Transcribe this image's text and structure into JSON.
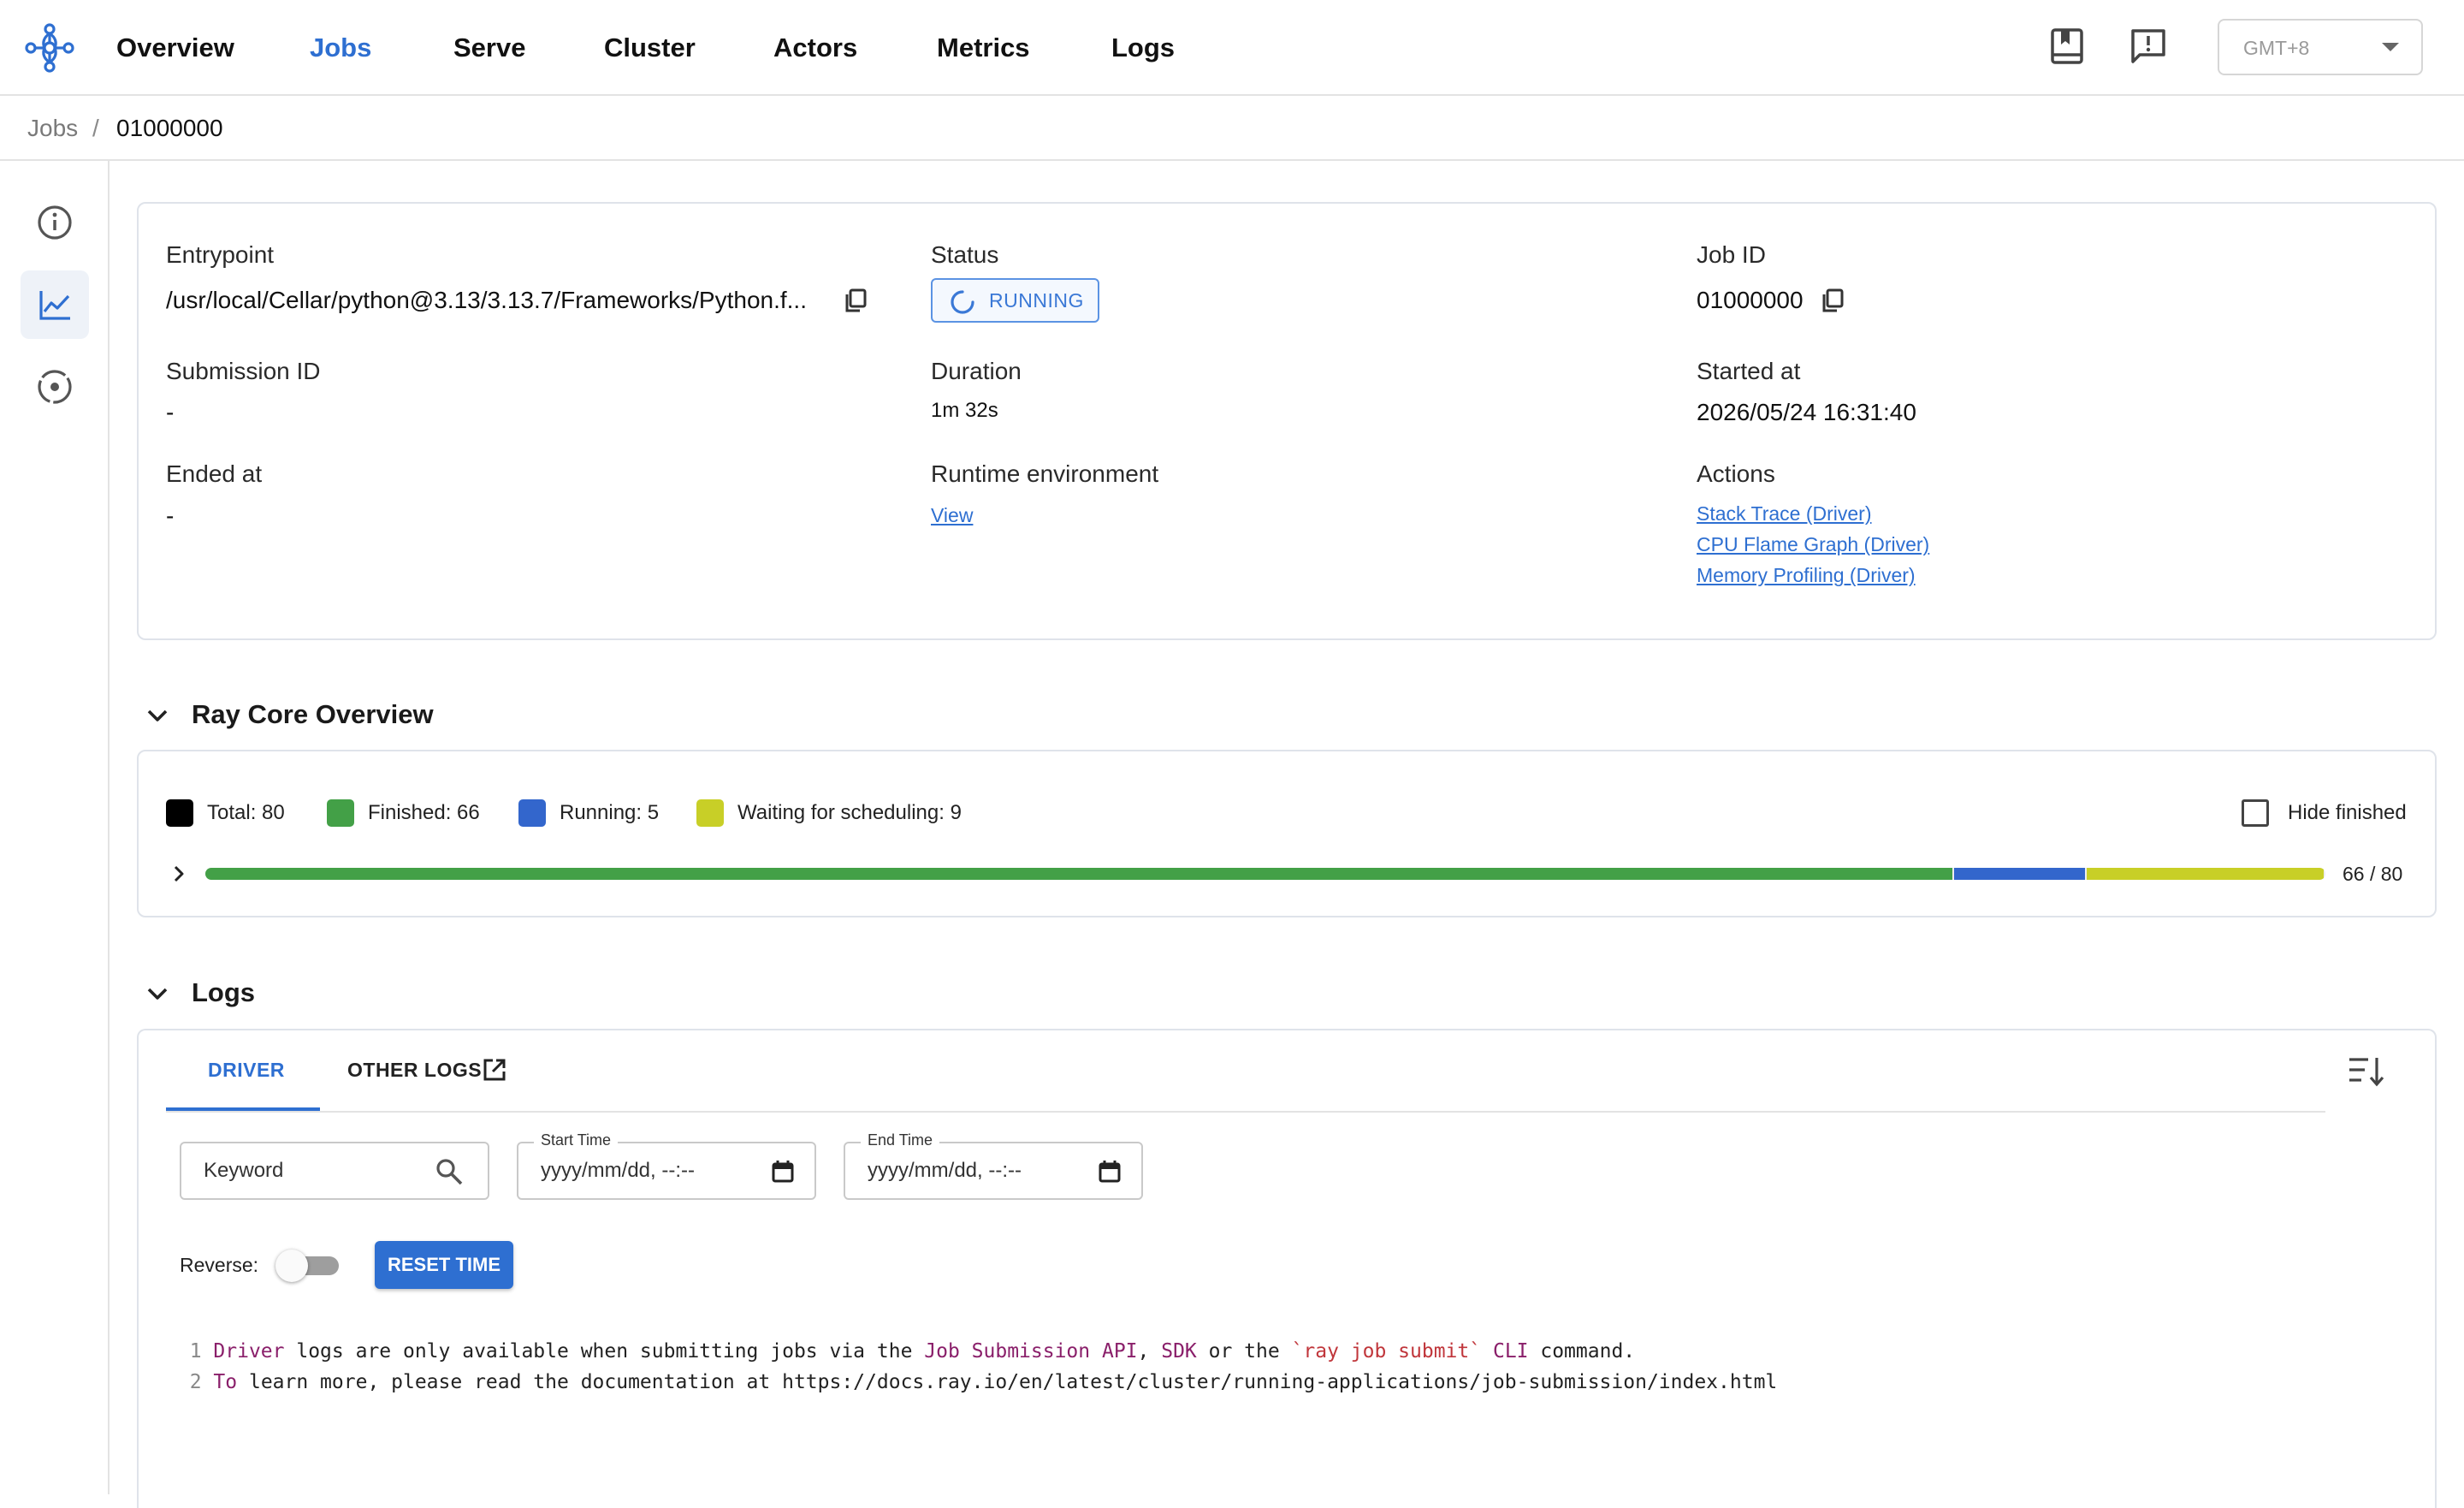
{
  "nav": {
    "items": [
      {
        "label": "Overview",
        "active": false
      },
      {
        "label": "Jobs",
        "active": true
      },
      {
        "label": "Serve",
        "active": false
      },
      {
        "label": "Cluster",
        "active": false
      },
      {
        "label": "Actors",
        "active": false
      },
      {
        "label": "Metrics",
        "active": false
      },
      {
        "label": "Logs",
        "active": false
      }
    ],
    "icons": [
      "docs-icon",
      "feedback-icon"
    ],
    "timezone": "GMT+8"
  },
  "breadcrumb": {
    "root": "Jobs",
    "separator": "/",
    "current": "01000000"
  },
  "siderail": {
    "icons": [
      "info-icon",
      "chart-icon",
      "target-icon"
    ],
    "active_index": 1
  },
  "details": {
    "entrypoint_label": "Entrypoint",
    "entrypoint_value": "/usr/local/Cellar/python@3.13/3.13.7/Frameworks/Python.f...",
    "status_label": "Status",
    "status_value": "RUNNING",
    "job_id_label": "Job ID",
    "job_id_value": "01000000",
    "submission_id_label": "Submission ID",
    "submission_id_value": "-",
    "duration_label": "Duration",
    "duration_value": "1m 32s",
    "started_label": "Started at",
    "started_value": "2026/05/24 16:31:40",
    "ended_label": "Ended at",
    "ended_value": "-",
    "runtime_label": "Runtime environment",
    "runtime_link": "View",
    "actions_label": "Actions",
    "actions": [
      "Stack Trace (Driver)",
      "CPU Flame Graph (Driver)",
      "Memory Profiling (Driver)"
    ]
  },
  "overview": {
    "title": "Ray Core Overview",
    "legend": [
      {
        "label": "Total: 80",
        "color": "#000000"
      },
      {
        "label": "Finished: 66",
        "color": "#43a047"
      },
      {
        "label": "Running: 5",
        "color": "#3366cc"
      },
      {
        "label": "Waiting for scheduling: 9",
        "color": "#c8cf27"
      }
    ],
    "hide_finished_label": "Hide finished",
    "hide_finished_checked": false,
    "progress": {
      "total": 80,
      "finished": 66,
      "running": 5,
      "waiting": 9
    },
    "progress_text": "66 / 80"
  },
  "logs": {
    "title": "Logs",
    "tabs": [
      "DRIVER",
      "OTHER LOGS"
    ],
    "active_tab": 0,
    "keyword_placeholder": "Keyword",
    "start_time_label": "Start Time",
    "start_time_placeholder": "yyyy/mm/dd, --:--",
    "end_time_label": "End Time",
    "end_time_placeholder": "yyyy/mm/dd, --:--",
    "reverse_label": "Reverse:",
    "reverse_on": false,
    "reset_label": "RESET TIME",
    "lines": [
      {
        "num": "1",
        "parts": [
          {
            "t": "Driver",
            "c": "kw"
          },
          {
            "t": " logs are only available when submitting jobs via the ",
            "c": ""
          },
          {
            "t": "Job Submission API",
            "c": "kw"
          },
          {
            "t": ", ",
            "c": ""
          },
          {
            "t": "SDK",
            "c": "kw"
          },
          {
            "t": " or the ",
            "c": ""
          },
          {
            "t": "`ray job submit`",
            "c": "str"
          },
          {
            "t": " ",
            "c": ""
          },
          {
            "t": "CLI",
            "c": "kw"
          },
          {
            "t": " command.",
            "c": ""
          }
        ]
      },
      {
        "num": "2",
        "parts": [
          {
            "t": "To",
            "c": "kw"
          },
          {
            "t": " learn more, please read the documentation at https://docs.ray.io/en/latest/cluster/running-applications/job-submission/index.html",
            "c": ""
          }
        ]
      }
    ]
  }
}
